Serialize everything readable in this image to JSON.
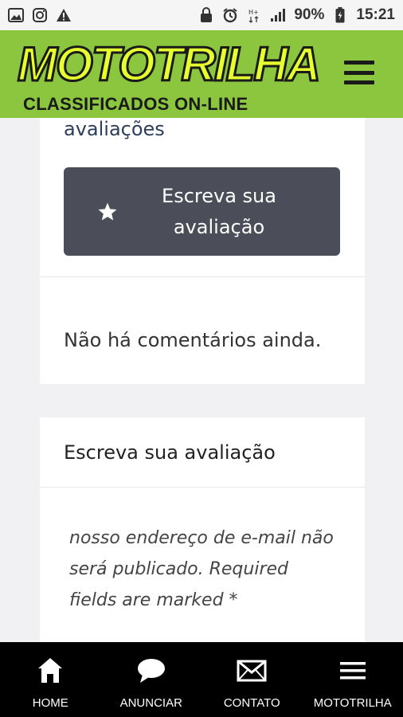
{
  "status_bar": {
    "battery": "90%",
    "time": "15:21",
    "left_icons": [
      "image-icon",
      "instagram-icon",
      "warning-icon"
    ],
    "right_icons": [
      "lock-icon",
      "alarm-icon",
      "hplus-icon",
      "signal-icon",
      "battery-icon"
    ]
  },
  "header": {
    "logo_main": "MOTOTRILHA",
    "logo_sub": "CLASSIFICADOS ON-LINE",
    "menu_icon": "hamburger-menu-icon",
    "colors": {
      "background": "#8cc63f",
      "logo_fill": "#e6ff2e",
      "logo_outline": "#1a1a1a"
    }
  },
  "reviews": {
    "title": "avaliações",
    "write_button_label": "Escreva sua avaliação",
    "write_button_icon": "star-icon",
    "no_comments": "Não há comentários ainda."
  },
  "review_form": {
    "title": "Escreva sua avaliação",
    "notice": "nosso endereço de e-mail não será publicado. Required fields are marked *"
  },
  "bottom_nav": {
    "items": [
      {
        "label": "HOME",
        "icon": "home-icon"
      },
      {
        "label": "ANUNCIAR",
        "icon": "chat-bubble-icon"
      },
      {
        "label": "CONTATO",
        "icon": "envelope-icon"
      },
      {
        "label": "MOTOTRILHA",
        "icon": "menu-icon"
      }
    ]
  }
}
